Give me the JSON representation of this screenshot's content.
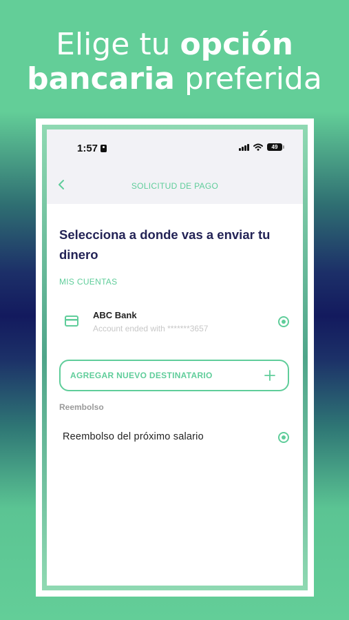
{
  "promo": {
    "line1_light": "Elige tu",
    "line1_bold": "opción",
    "line2_bold": "bancaria",
    "line2_light": "preferida"
  },
  "status_bar": {
    "time": "1:57",
    "battery": "49"
  },
  "header": {
    "title": "SOLICITUD DE PAGO",
    "back_icon": "chevron-left-icon"
  },
  "main": {
    "heading": "Selecciona a donde vas a enviar tu dinero",
    "accounts_label": "MIS CUENTAS",
    "accounts": [
      {
        "name": "ABC Bank",
        "subtitle": "Account ended with *******3657",
        "icon": "credit-card-icon",
        "selected": true
      }
    ],
    "add_button": {
      "label": "AGREGAR NUEVO DESTINATARIO",
      "icon": "plus-icon"
    },
    "reimbursement_label": "Reembolso",
    "reimbursement_options": [
      {
        "label": "Reembolso del próximo salario",
        "selected": true
      }
    ]
  },
  "colors": {
    "accent": "#5fcd9a",
    "heading": "#232356",
    "background_green": "#63ce98",
    "background_navy": "#131a5e"
  }
}
